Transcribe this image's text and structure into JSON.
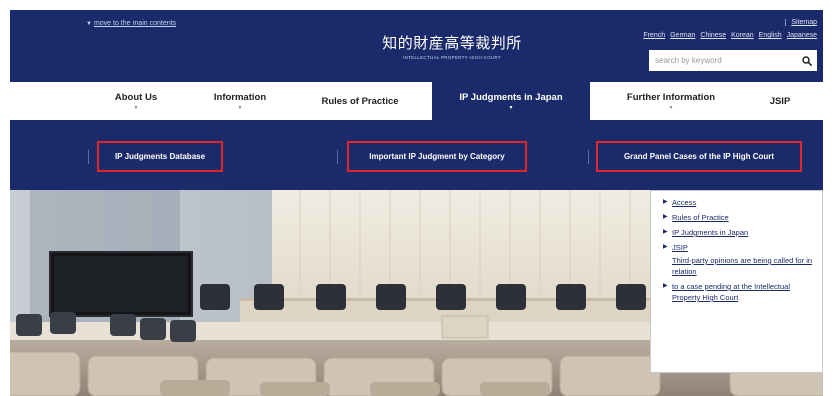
{
  "header": {
    "skip_link": "move to the main contents",
    "logo_jp": "知的財産高等裁判所",
    "logo_en": "INTELLECTUAL PROPERTY HIGH COURT",
    "sitemap": "Sitemap",
    "languages": [
      "French",
      "German",
      "Chinese",
      "Korean",
      "English",
      "Japanese"
    ],
    "search_placeholder": "search by keyword",
    "search_icon": "magnifier-icon"
  },
  "nav": {
    "items": [
      {
        "label": "About Us",
        "has_dropdown": true
      },
      {
        "label": "Information",
        "has_dropdown": true
      },
      {
        "label": "Rules of Practice",
        "has_dropdown": false
      },
      {
        "label": "IP Judgments in Japan",
        "has_dropdown": true,
        "active": true
      },
      {
        "label": "Further Information",
        "has_dropdown": true
      },
      {
        "label": "JSIP",
        "has_dropdown": false
      }
    ]
  },
  "subnav": {
    "items": [
      "IP Judgments Database",
      "Important IP Judgment by Category",
      "Grand Panel Cases of the IP High Court"
    ],
    "highlight_color": "#e4262a"
  },
  "popup": {
    "items": [
      "Access",
      "Rules of Practice",
      "IP Judgments in Japan",
      "JSIP"
    ],
    "note": "Third-party opinions are being called for in relation",
    "last_item": "to a case pending at the Intellectual Property High Court"
  },
  "colors": {
    "brand_navy": "#1b2a6b",
    "highlight_red": "#e4262a"
  }
}
